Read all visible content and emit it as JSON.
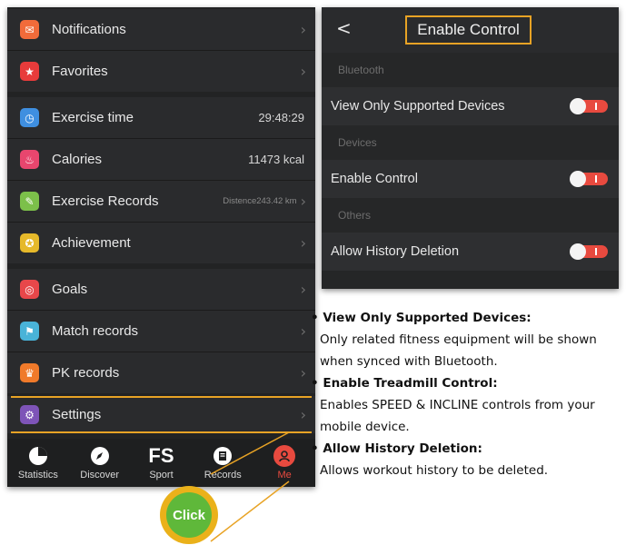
{
  "left_screen": {
    "menu": [
      {
        "label": "Notifications",
        "icon": "envelope-icon",
        "icon_color": "#f26b3a",
        "value": "",
        "chevron": true
      },
      {
        "label": "Favorites",
        "icon": "star-icon",
        "icon_color": "#e83b3b",
        "value": "",
        "chevron": true
      },
      {
        "label": "Exercise time",
        "icon": "clock-icon",
        "icon_color": "#3f8fe0",
        "value": "29:48:29",
        "chevron": false
      },
      {
        "label": "Calories",
        "icon": "flame-icon",
        "icon_color": "#e8466e",
        "value": "11473 kcal",
        "chevron": false
      },
      {
        "label": "Exercise Records",
        "icon": "notepad-icon",
        "icon_color": "#7cc04a",
        "value": "Distence243.42 km",
        "chevron": true
      },
      {
        "label": "Achievement",
        "icon": "medal-icon",
        "icon_color": "#e6b92a",
        "value": "",
        "chevron": true
      },
      {
        "label": "Goals",
        "icon": "target-icon",
        "icon_color": "#e8474a",
        "value": "",
        "chevron": true
      },
      {
        "label": "Match records",
        "icon": "flag-icon",
        "icon_color": "#49b3d8",
        "value": "",
        "chevron": true
      },
      {
        "label": "PK records",
        "icon": "trophy-icon",
        "icon_color": "#f07a2a",
        "value": "",
        "chevron": true
      },
      {
        "label": "Settings",
        "icon": "gear-icon",
        "icon_color": "#7e54b8",
        "value": "",
        "chevron": true
      }
    ],
    "tabs": [
      {
        "label": "Statistics",
        "icon": "pie-chart-icon"
      },
      {
        "label": "Discover",
        "icon": "compass-icon"
      },
      {
        "label": "Sport",
        "icon": "fs-logo-icon"
      },
      {
        "label": "Records",
        "icon": "records-icon"
      },
      {
        "label": "Me",
        "icon": "person-icon",
        "active": true
      }
    ],
    "accent_color": "#e84a3f",
    "highlight_color": "#e8a325"
  },
  "right_screen": {
    "back_glyph": "<",
    "title": "Enable Control",
    "sections": [
      {
        "header": "Bluetooth",
        "row": "View Only Supported Devices",
        "toggle": "on"
      },
      {
        "header": "Devices",
        "row": "Enable Control",
        "toggle": "on"
      },
      {
        "header": "Others",
        "row": "Allow History Deletion",
        "toggle": "on"
      }
    ]
  },
  "notes": [
    {
      "heading": "View Only Supported Devices:",
      "lines": [
        "Only related fitness equipment will be shown",
        "when synced with Bluetooth."
      ]
    },
    {
      "heading": "Enable Treadmill Control:",
      "lines": [
        "Enables SPEED & INCLINE controls from your",
        "mobile device."
      ]
    },
    {
      "heading": "Allow History Deletion:",
      "lines": [
        "Allows workout history to be deleted."
      ]
    }
  ],
  "click_badge": "Click"
}
